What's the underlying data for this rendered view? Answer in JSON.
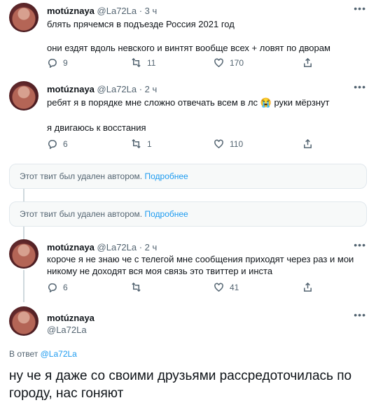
{
  "tweets": [
    {
      "name": "motúznaya",
      "handle": "@La72La",
      "time": "· 3 ч",
      "lines": [
        "блять прячемся в подъезде Россия 2021 год",
        "",
        "они ездят вдоль невского и винтят вообще всех + ловят по дворам"
      ],
      "replies": "9",
      "retweets": "11",
      "likes": "170"
    },
    {
      "name": "motúznaya",
      "handle": "@La72La",
      "time": "· 2 ч",
      "lines": [
        "ребят я в порядке мне сложно отвечать всем в лс 😭 руки мёрзнут",
        "",
        "я двигаюсь к восстания"
      ],
      "replies": "6",
      "retweets": "1",
      "likes": "110"
    },
    {
      "name": "motúznaya",
      "handle": "@La72La",
      "time": "· 2 ч",
      "lines": [
        "короче я не знаю че с телегой мне сообщения приходят через раз и мои",
        "никому не доходят вся моя связь это твиттер и инста"
      ],
      "replies": "6",
      "retweets": "",
      "likes": "41"
    }
  ],
  "deleted_notice": {
    "text": "Этот твит был удален автором.",
    "link": "Подробнее"
  },
  "main_tweet": {
    "name": "motúznaya",
    "handle": "@La72La",
    "reply_prefix": "В ответ",
    "reply_to": "@La72La",
    "text": "ну че я даже со своими друзьями рассредоточилась по городу, нас гоняют"
  },
  "icons": [
    "more-icon",
    "reply-icon",
    "retweet-icon",
    "like-icon",
    "share-icon"
  ],
  "colors": {
    "accent": "#1d9bf0",
    "muted": "#536471",
    "text": "#0f1419",
    "border": "#e1e8ed"
  }
}
